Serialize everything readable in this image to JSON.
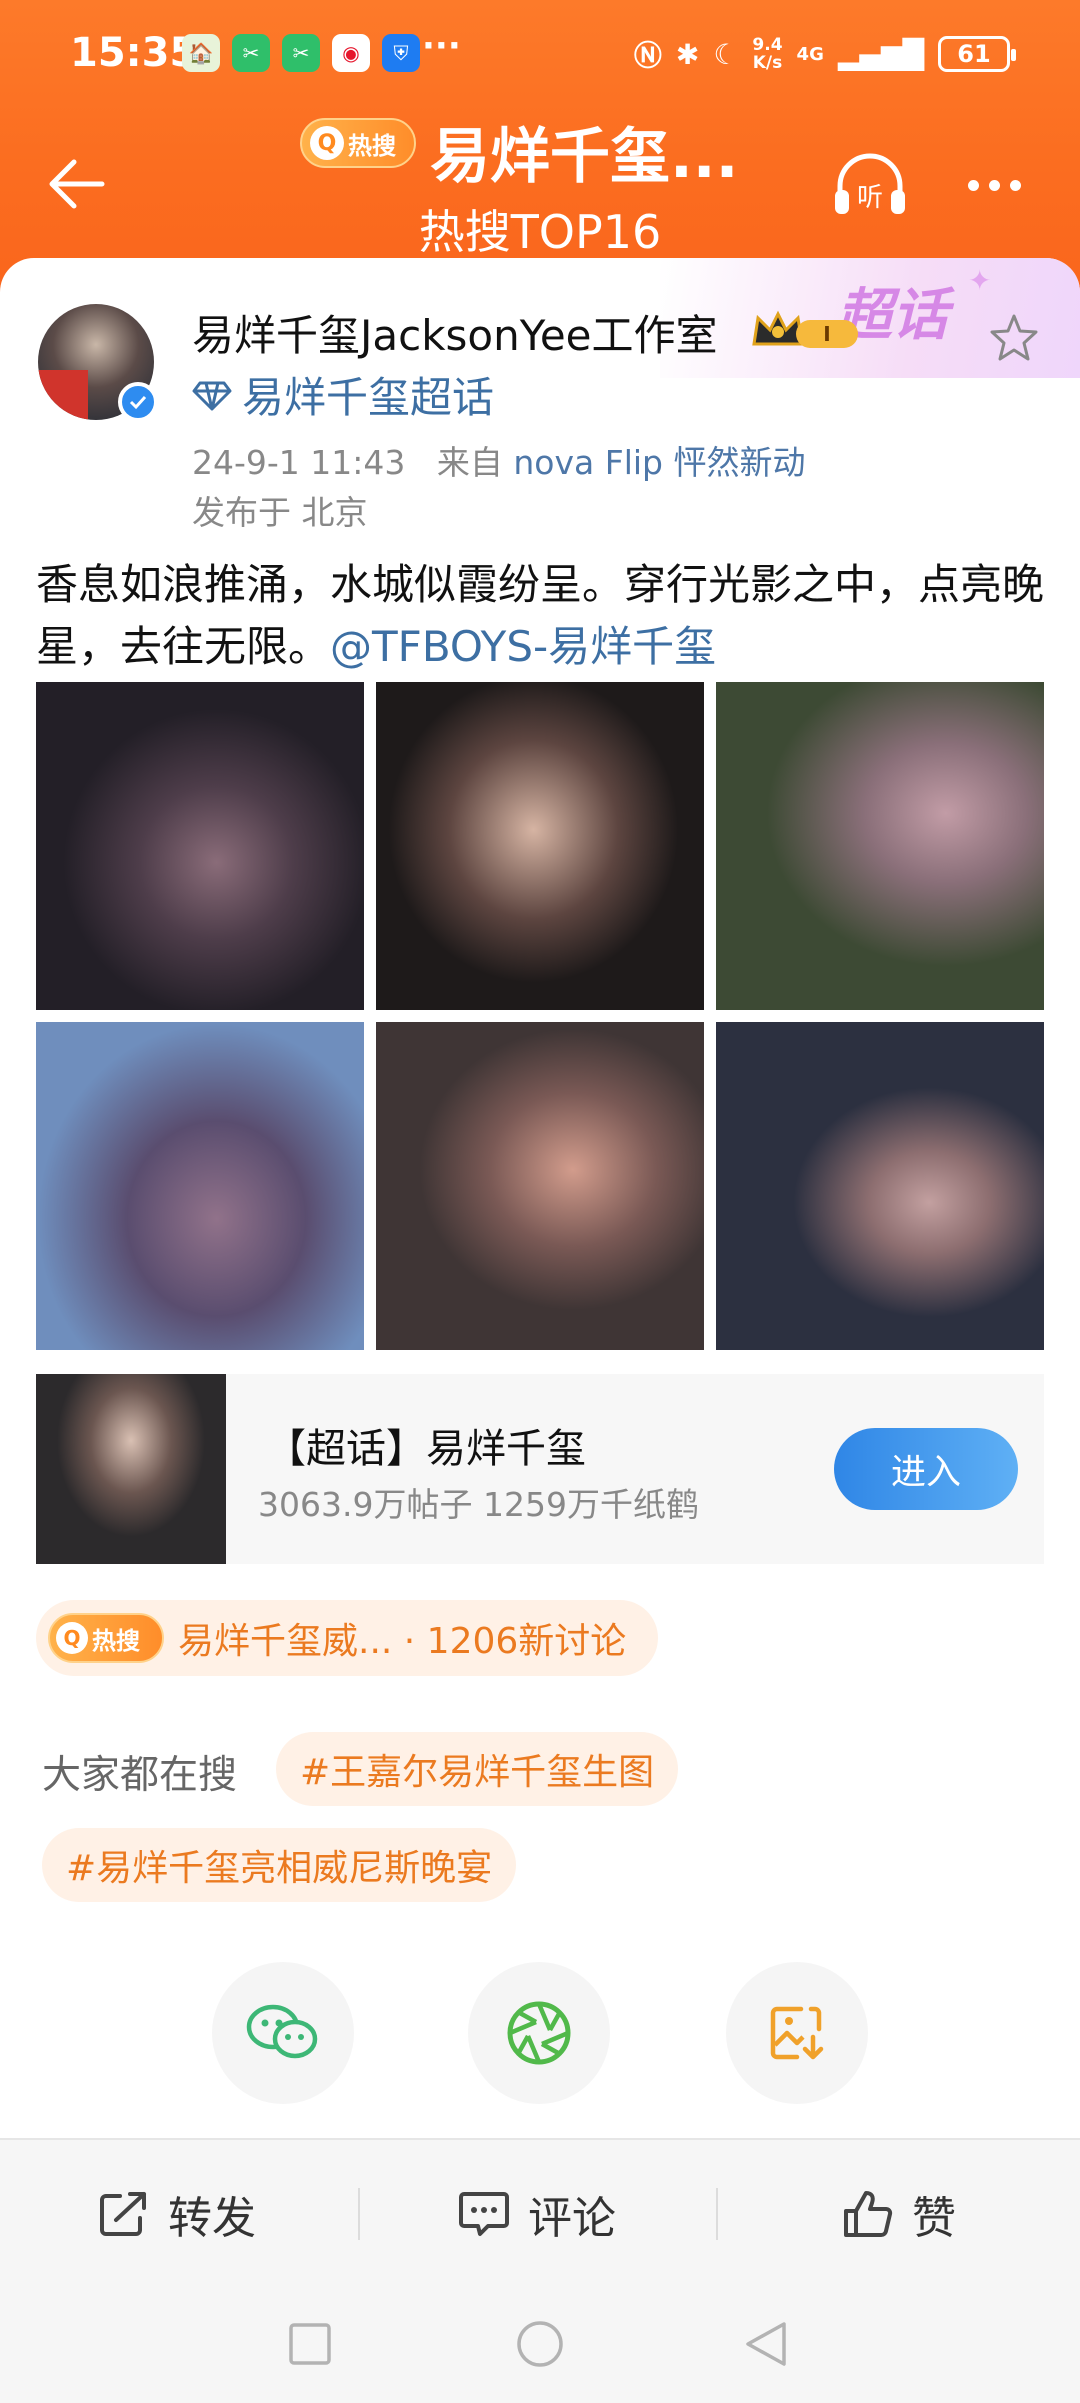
{
  "status_bar": {
    "time": "15:35",
    "more_indicator": "···",
    "net_speed_value": "9.4",
    "net_speed_unit": "K/s",
    "signal": "4G",
    "battery": "61"
  },
  "header": {
    "hot_badge_label": "热搜",
    "title": "易烊千玺...",
    "subtitle": "热搜TOP16",
    "listen_label": "听"
  },
  "post": {
    "supertopic_tag": "超话",
    "author_name": "易烊千玺JacksonYee工作室",
    "crown_level": "I",
    "supertopic_link": "易烊千玺超话",
    "timestamp": "24-9-1 11:43",
    "source_prefix": "来自",
    "source": "nova Flip 怦然新动",
    "location": "发布于 北京",
    "text": "香息如浪推涌，水城似霞纷呈。穿行光影之中，点亮晚星，去往无限。",
    "mention": "@TFBOYS-易烊千玺"
  },
  "supertopic_card": {
    "name": "【超话】易烊千玺",
    "stats": "3063.9万帖子 1259万千纸鹤",
    "enter_label": "进入"
  },
  "hot_search": {
    "badge_label": "热搜",
    "text": "易烊千玺威... · 1206新讨论"
  },
  "others_search": {
    "label": "大家都在搜",
    "tags": [
      "#王嘉尔易烊千玺生图",
      "#易烊千玺亮相威尼斯晚宴"
    ]
  },
  "actions": {
    "repost": "转发",
    "comment": "评论",
    "like": "赞"
  },
  "colors": {
    "header_orange": "#fb6d20",
    "link_blue": "#3d6fa3",
    "hot_orange": "#eb7a20",
    "button_blue": "#2f86e6",
    "wechat_green": "#3db776"
  }
}
